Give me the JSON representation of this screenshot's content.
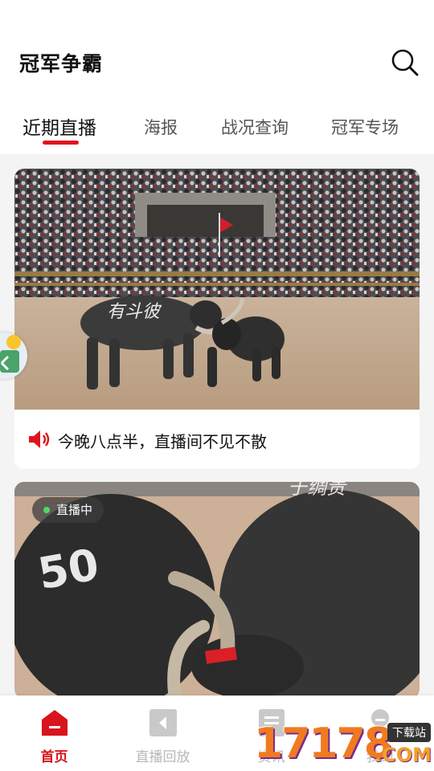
{
  "header": {
    "title": "冠军争霸",
    "search_icon": "search-icon"
  },
  "tabs": [
    {
      "label": "近期直播",
      "active": true
    },
    {
      "label": "海报",
      "active": false
    },
    {
      "label": "战况查询",
      "active": false
    },
    {
      "label": "冠军专场",
      "active": false
    }
  ],
  "cards": [
    {
      "image": "bullfight-arena-crowd",
      "notice_icon": "speaker-icon",
      "notice_text": "今晚八点半，直播间不见不散"
    },
    {
      "image": "bullfight-close-up",
      "badge": "直播中",
      "bull_number": "50"
    }
  ],
  "bottom_nav": [
    {
      "label": "首页",
      "icon": "home-icon",
      "active": true
    },
    {
      "label": "直播回放",
      "icon": "playback-icon",
      "active": false
    },
    {
      "label": "资讯",
      "icon": "news-icon",
      "active": false
    },
    {
      "label": "我的",
      "icon": "profile-icon",
      "active": false
    }
  ],
  "watermark": {
    "digits": "17178",
    "domain": ".COM",
    "site": "下载站"
  },
  "colors": {
    "accent": "#e0141f",
    "inactive": "#b8b8b8",
    "background": "#f4f4f4"
  }
}
